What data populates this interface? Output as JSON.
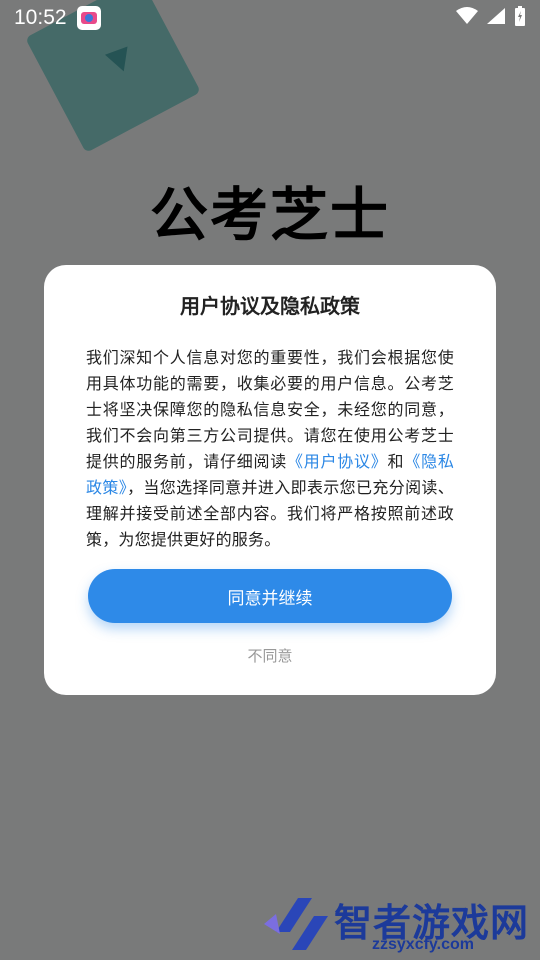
{
  "status_bar": {
    "time": "10:52",
    "app_icon": "app-notification-icon",
    "icons": [
      "wifi-icon",
      "signal-icon",
      "battery-icon"
    ]
  },
  "background": {
    "app_title": "公考芝士"
  },
  "dialog": {
    "title": "用户协议及隐私政策",
    "body": {
      "part1": "我们深知个人信息对您的重要性，我们会根据您使用具体功能的需要，收集必要的用户信息。公考芝士将坚决保障您的隐私信息安全，未经您的同意，我们不会向第三方公司提供。请您在使用公考芝士提供的服务前，请仔细阅读",
      "link_user_agreement": "《用户协议》",
      "connector": "和",
      "link_privacy_policy": "《隐私政策》",
      "part2": "，当您选择同意并进入即表示您已充分阅读、理解并接受前述全部内容。我们将严格按照前述政策，为您提供更好的服务。"
    },
    "agree_label": "同意并继续",
    "disagree_label": "不同意"
  },
  "watermark": {
    "text": "智者游戏网",
    "url": "zzsyxcfy.com"
  },
  "colors": {
    "accent": "#2e8ae8",
    "link": "#2b87e5",
    "overlay": "rgba(0,0,0,0.5)"
  }
}
